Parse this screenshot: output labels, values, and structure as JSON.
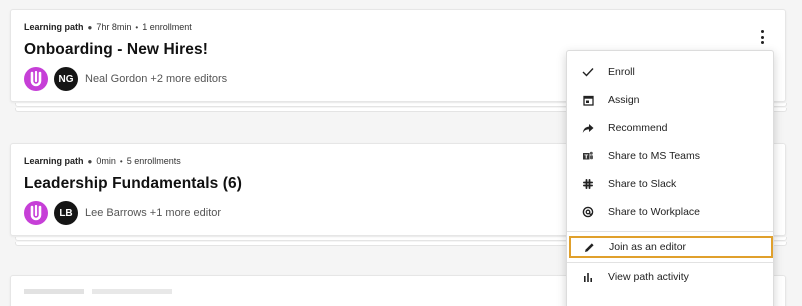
{
  "cards": [
    {
      "kind": "Learning path",
      "duration": "7hr 8min",
      "enrollments": "1 enrollment",
      "title": "Onboarding - New Hires!",
      "avatar_initials": "NG",
      "editors": "Neal Gordon +2 more editors"
    },
    {
      "kind": "Learning path",
      "duration": "0min",
      "enrollments": "5 enrollments",
      "title": "Leadership Fundamentals (6)",
      "avatar_initials": "LB",
      "editors": "Lee Barrows +1 more editor"
    }
  ],
  "menu": {
    "items": [
      {
        "label": "Enroll",
        "icon": "check-icon"
      },
      {
        "label": "Assign",
        "icon": "calendar-icon"
      },
      {
        "label": "Recommend",
        "icon": "share-arrow-icon"
      },
      {
        "label": "Share to MS Teams",
        "icon": "ms-teams-icon"
      },
      {
        "label": "Share to Slack",
        "icon": "slack-icon"
      },
      {
        "label": "Share to Workplace",
        "icon": "workplace-icon"
      },
      {
        "label": "Join as an editor",
        "icon": "pencil-icon"
      },
      {
        "label": "View path activity",
        "icon": "bar-chart-icon"
      }
    ],
    "highlighted_item": "Join as an editor"
  },
  "colors": {
    "brand_logo": "#c63fd7",
    "highlight_outline": "#e0a02c",
    "avatar_bg": "#151515"
  }
}
